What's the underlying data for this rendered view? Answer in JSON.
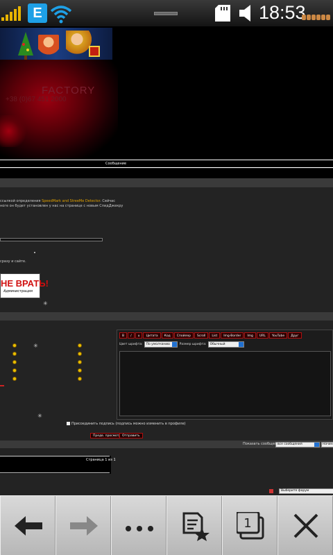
{
  "status_bar": {
    "network_type": "E",
    "time": "18:53",
    "icons": [
      "signal-icon",
      "edge-network-icon",
      "wifi-icon",
      "sd-card-icon",
      "volume-icon",
      "battery-icon"
    ]
  },
  "page": {
    "banner": {
      "brand_text": "FACTORY",
      "phone_text": "+38 (0)67 451 2000"
    },
    "message_header": "Сообщение",
    "intro_line1_pre": "ссылкой определения",
    "intro_line1_hl": "SpeedMark and StreeMe Detector",
    "intro_line1_post": ". Сейчас",
    "intro_line2": "ноге он будет установлен у нас на странице с новым СпидДжекру",
    "site_text": "сразу и сайте.",
    "ad": {
      "line1": "НЕ ВРАТЬ!",
      "line2": "Администрация"
    },
    "editor": {
      "buttons": [
        "B",
        "/",
        "u",
        "Цитата",
        "Код",
        "Спойлер",
        "Scroll",
        "List",
        "Img-Border",
        "Img",
        "URL",
        "YouTube",
        "Друг"
      ],
      "font_color_label": "Цвет шрифта:",
      "font_color_value": "По умолчанию",
      "font_size_label": "Размер шрифта:",
      "font_size_value": "Обычный"
    },
    "signature_checkbox": "Присоединить подпись (подпись можно изменить в профиле)",
    "preview_button": "Предв. просмотр",
    "send_button": "Отправить",
    "show_messages_label": "Показать сообщения:",
    "show_messages_value": "все сообщения",
    "start_label": "Начиная",
    "pager_text": "Страница 1 из 1",
    "forum_select": "Выберите форум"
  },
  "colors": {
    "accent_red": "#b01010",
    "highlight": "#e0a000",
    "network_blue": "#1ea0e6"
  },
  "toolbar": {
    "items": [
      {
        "icon": "back-arrow-icon"
      },
      {
        "icon": "forward-arrow-icon"
      },
      {
        "icon": "more-dots-icon"
      },
      {
        "icon": "bookmarks-icon"
      },
      {
        "icon": "windows-icon",
        "count": "1"
      },
      {
        "icon": "close-icon"
      }
    ]
  }
}
